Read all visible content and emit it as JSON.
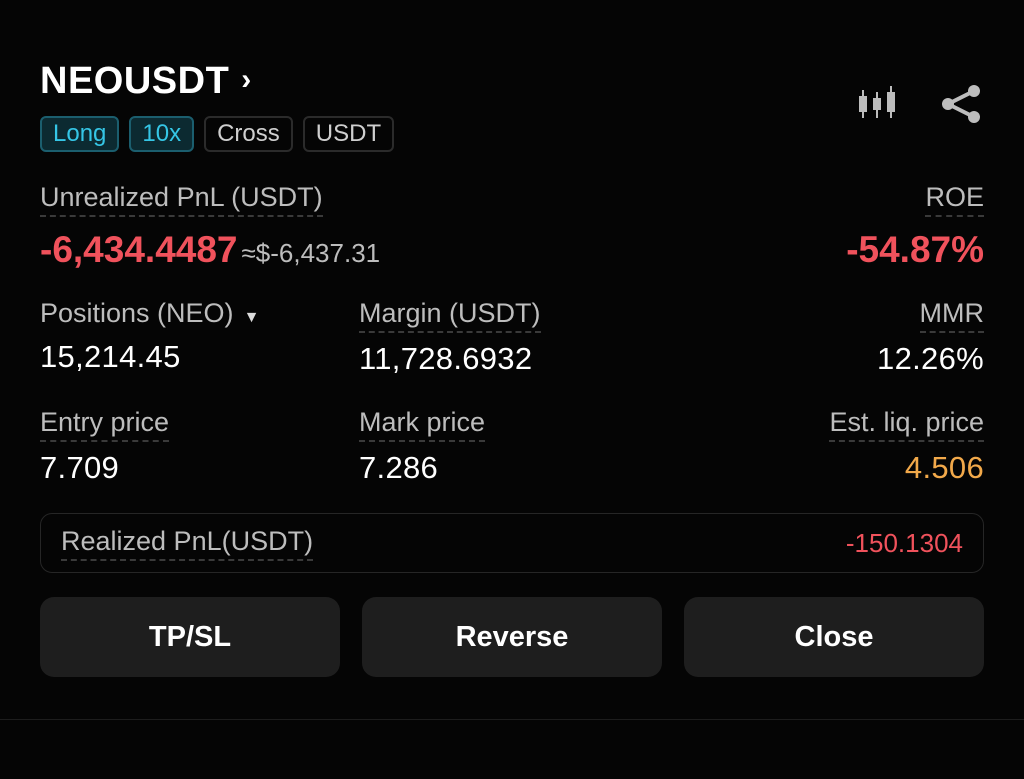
{
  "header": {
    "symbol": "NEOUSDT",
    "chevron": "›",
    "tags": [
      "Long",
      "10x",
      "Cross",
      "USDT"
    ],
    "icons": [
      "candlestick-chart-icon",
      "share-icon"
    ]
  },
  "pnl": {
    "label": "Unrealized PnL (USDT)",
    "value": "-6,434.4487",
    "approx": "≈$-6,437.31",
    "roe_label": "ROE",
    "roe_value": "-54.87%"
  },
  "stats": {
    "positions_label": "Positions (NEO)",
    "positions_value": "15,214.45",
    "margin_label": "Margin (USDT)",
    "margin_value": "11,728.6932",
    "mmr_label": "MMR",
    "mmr_value": "12.26%",
    "entry_label": "Entry price",
    "entry_value": "7.709",
    "mark_label": "Mark price",
    "mark_value": "7.286",
    "liq_label": "Est. liq. price",
    "liq_value": "4.506"
  },
  "realized": {
    "label": "Realized PnL(USDT)",
    "value": "-150.1304"
  },
  "buttons": {
    "tpsl": "TP/SL",
    "reverse": "Reverse",
    "close": "Close"
  },
  "colors": {
    "negative": "#f0525c",
    "warning": "#f2a94a",
    "accent": "#35c6e6",
    "background": "#050505"
  }
}
